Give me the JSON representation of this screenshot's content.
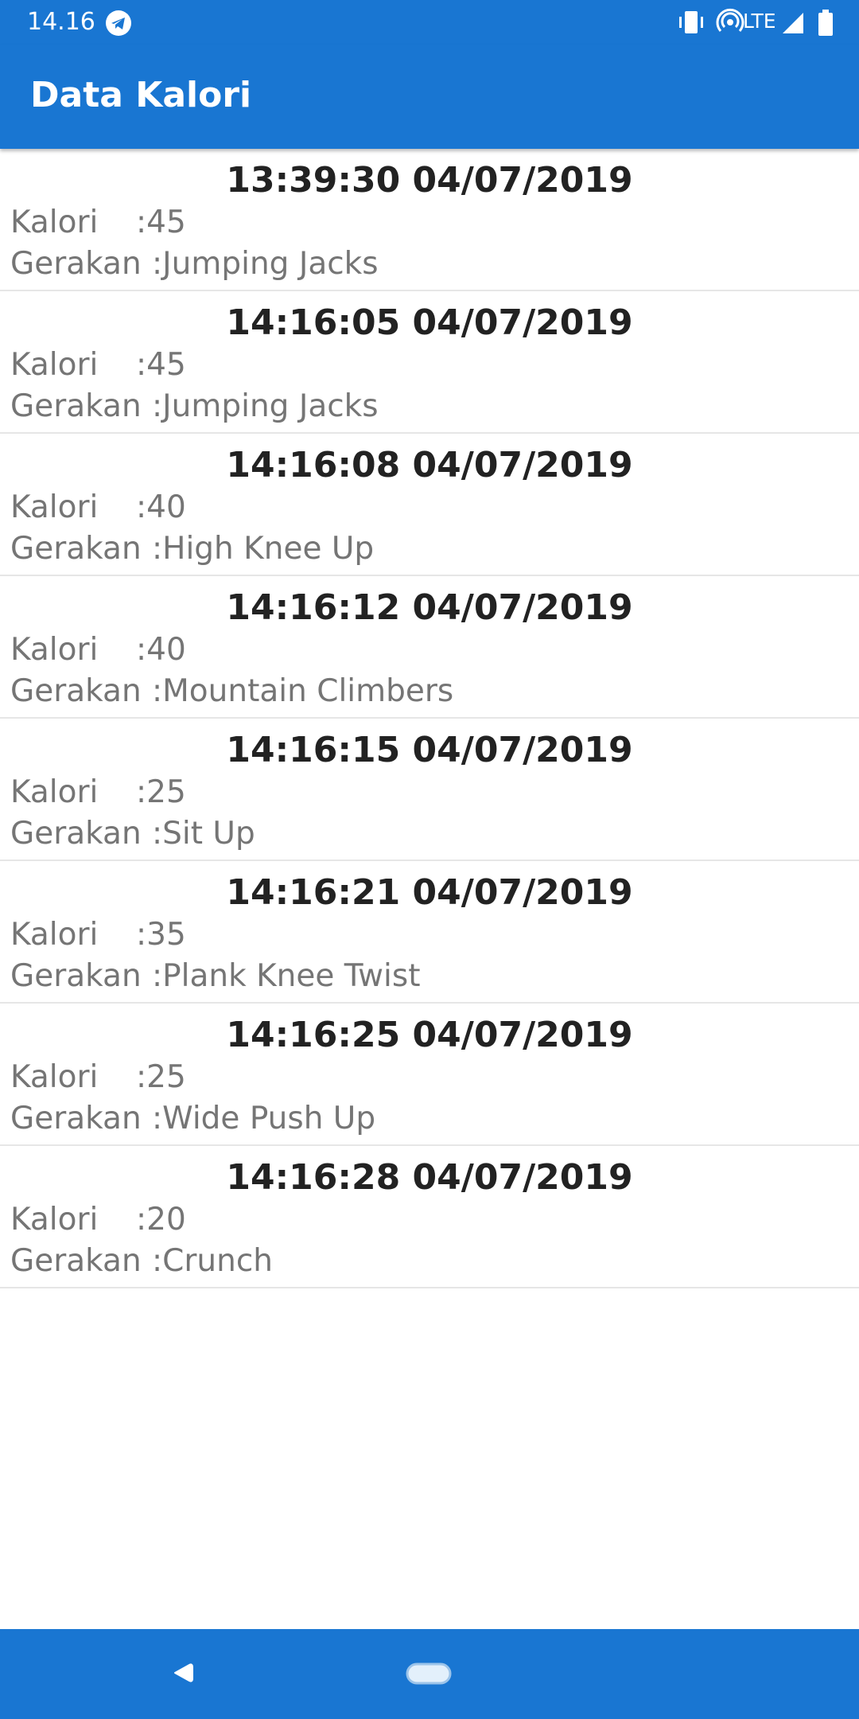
{
  "status_bar": {
    "time": "14.16",
    "network_label": "LTE",
    "icons": [
      "telegram-icon",
      "vibrate-icon",
      "hotspot-icon",
      "signal-icon",
      "battery-icon"
    ]
  },
  "app_bar": {
    "title": "Data Kalori"
  },
  "labels": {
    "kalori": "Kalori",
    "gerakan": "Gerakan",
    "separator": ": "
  },
  "entries": [
    {
      "datetime": "13:39:30 04/07/2019",
      "kalori": "45",
      "gerakan": "Jumping Jacks"
    },
    {
      "datetime": "14:16:05 04/07/2019",
      "kalori": "45",
      "gerakan": "Jumping Jacks"
    },
    {
      "datetime": "14:16:08 04/07/2019",
      "kalori": "40",
      "gerakan": "High Knee Up"
    },
    {
      "datetime": "14:16:12 04/07/2019",
      "kalori": "40",
      "gerakan": "Mountain Climbers"
    },
    {
      "datetime": "14:16:15 04/07/2019",
      "kalori": "25",
      "gerakan": "Sit Up"
    },
    {
      "datetime": "14:16:21 04/07/2019",
      "kalori": "35",
      "gerakan": "Plank Knee Twist"
    },
    {
      "datetime": "14:16:25 04/07/2019",
      "kalori": "25",
      "gerakan": "Wide Push Up"
    },
    {
      "datetime": "14:16:28 04/07/2019",
      "kalori": "20",
      "gerakan": "Crunch"
    }
  ],
  "colors": {
    "primary": "#1976d2",
    "title_text": "#ffffff",
    "datetime_text": "#222222",
    "body_text": "#757575",
    "divider": "#e6e6e6"
  }
}
